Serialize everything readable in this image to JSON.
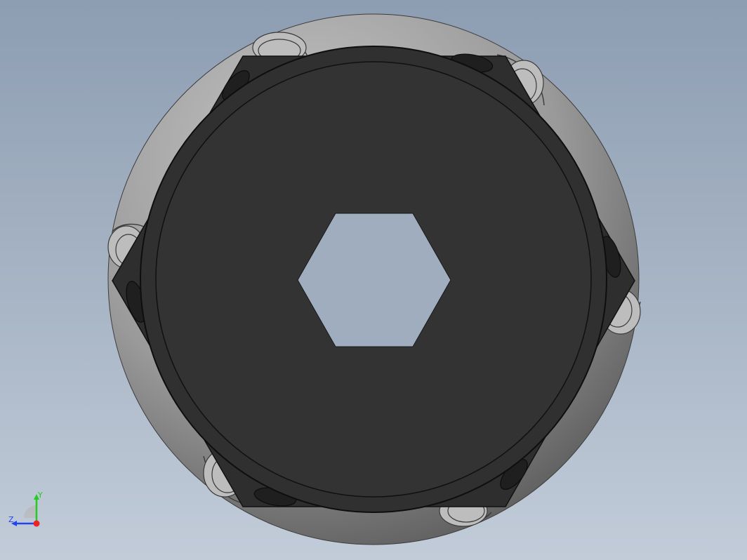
{
  "scene": {
    "colors": {
      "background_top": "#8d9db2",
      "background_bottom": "#c2ccd9",
      "roller_light": "#b4b4b4",
      "roller_dark": "#5a5a5a",
      "hub_plate": "#333333",
      "hub_edge": "#111111",
      "bore": "#9faec1"
    }
  },
  "triad": {
    "y_label": "Y",
    "z_label": "Z",
    "y_color": "#22cc22",
    "z_color": "#2244ee",
    "x_color": "#ee2222"
  }
}
